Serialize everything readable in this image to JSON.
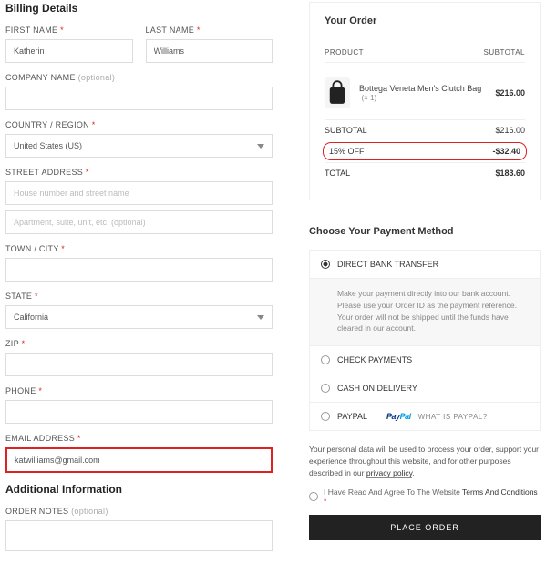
{
  "billing": {
    "title": "Billing Details",
    "first_name": {
      "label": "FIRST NAME",
      "value": "Katherin"
    },
    "last_name": {
      "label": "LAST NAME",
      "value": "Williams"
    },
    "company": {
      "label": "COMPANY NAME",
      "optional": "(optional)"
    },
    "country": {
      "label": "COUNTRY / REGION",
      "value": "United States (US)"
    },
    "street": {
      "label": "STREET ADDRESS",
      "placeholder1": "House number and street name",
      "placeholder2": "Apartment, suite, unit, etc. (optional)"
    },
    "town": {
      "label": "TOWN / CITY"
    },
    "state": {
      "label": "STATE",
      "value": "California"
    },
    "zip": {
      "label": "ZIP"
    },
    "phone": {
      "label": "PHONE"
    },
    "email": {
      "label": "EMAIL ADDRESS",
      "value": "katwilliams@gmail.com"
    }
  },
  "additional": {
    "title": "Additional Information",
    "notes_label": "ORDER NOTES",
    "optional": "(optional)"
  },
  "order": {
    "title": "Your Order",
    "hdr_product": "PRODUCT",
    "hdr_subtotal": "SUBTOTAL",
    "item": {
      "name": "Bottega Veneta Men's Clutch Bag",
      "qty": "(× 1)",
      "price": "$216.00"
    },
    "subtotal": {
      "label": "SUBTOTAL",
      "value": "$216.00"
    },
    "discount": {
      "label": "15% OFF",
      "value": "-$32.40"
    },
    "total": {
      "label": "TOTAL",
      "value": "$183.60"
    }
  },
  "payment": {
    "title": "Choose Your Payment Method",
    "bank": {
      "label": "DIRECT BANK TRANSFER",
      "desc": "Make your payment directly into our bank account. Please use your Order ID as the payment reference. Your order will not be shipped until the funds have cleared in our account."
    },
    "check": "CHECK PAYMENTS",
    "cod": "CASH ON DELIVERY",
    "paypal": "PAYPAL",
    "whatpp": "WHAT IS PAYPAL?"
  },
  "privacy": "Your personal data will be used to process your order, support your experience throughout this website, and for other purposes described in our ",
  "privacy_link": "privacy policy",
  "terms_pre": "I Have Read And Agree To The Website ",
  "terms_link": "Terms And Conditions",
  "place": "PLACE ORDER"
}
